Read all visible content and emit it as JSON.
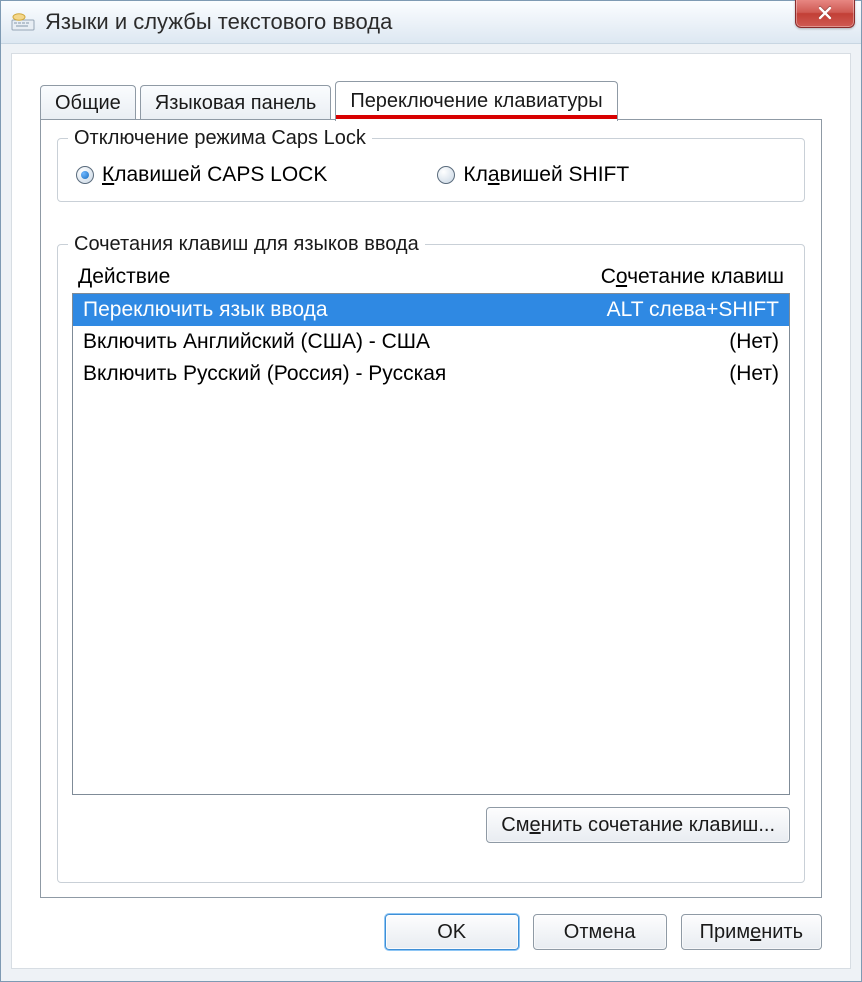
{
  "window": {
    "title": "Языки и службы текстового ввода"
  },
  "tabs": {
    "general": "Общие",
    "langbar": "Языковая панель",
    "switch": "Переключение клавиатуры"
  },
  "capslock_group": {
    "legend": "Отключение режима Caps Lock",
    "by_capslock_pre": "К",
    "by_capslock_rest": "лавишей CAPS LOCK",
    "by_shift_pre": "Кл",
    "by_shift_und": "а",
    "by_shift_rest": "вишей SHIFT"
  },
  "hotkeys_group": {
    "legend": "Сочетания клавиш для языков ввода",
    "col_action": "Действие",
    "col_hotkey_pre": "С",
    "col_hotkey_und": "о",
    "col_hotkey_rest": "четание клавиш",
    "rows": [
      {
        "action": "Переключить язык ввода",
        "hotkey": "ALT слева+SHIFT"
      },
      {
        "action": "Включить Английский (США) - США",
        "hotkey": "(Нет)"
      },
      {
        "action": "Включить Русский (Россия) - Русская",
        "hotkey": "(Нет)"
      }
    ],
    "change_btn_pre": "См",
    "change_btn_und": "е",
    "change_btn_rest": "нить сочетание клавиш..."
  },
  "buttons": {
    "ok": "OK",
    "cancel": "Отмена",
    "apply_pre": "Прим",
    "apply_und": "е",
    "apply_rest": "нить"
  }
}
